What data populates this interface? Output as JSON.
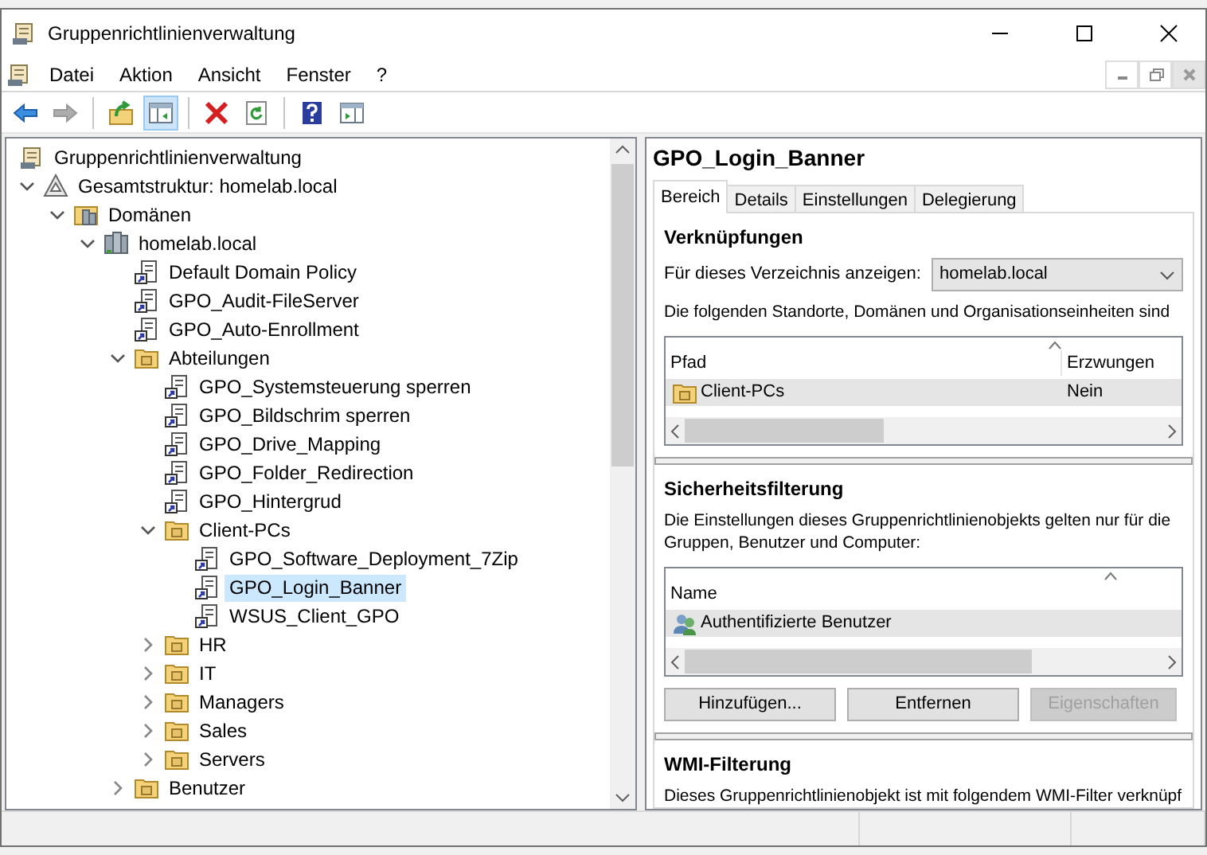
{
  "window": {
    "title": "Gruppenrichtlinienverwaltung"
  },
  "menu": [
    "Datei",
    "Aktion",
    "Ansicht",
    "Fenster",
    "?"
  ],
  "toolbar": [
    {
      "kind": "back",
      "disabled": false,
      "pressed": false
    },
    {
      "kind": "forward",
      "disabled": true,
      "pressed": false
    },
    {
      "kind": "separator"
    },
    {
      "kind": "up",
      "disabled": false,
      "pressed": false
    },
    {
      "kind": "tree",
      "disabled": false,
      "pressed": true
    },
    {
      "kind": "separator"
    },
    {
      "kind": "delete",
      "disabled": false,
      "pressed": false
    },
    {
      "kind": "refresh",
      "disabled": false,
      "pressed": false
    },
    {
      "kind": "separator"
    },
    {
      "kind": "help",
      "disabled": false,
      "pressed": false
    },
    {
      "kind": "pane",
      "disabled": false,
      "pressed": false
    }
  ],
  "tree": [
    {
      "label": "Gruppenrichtlinienverwaltung",
      "kind": "root",
      "selected": false,
      "children": [
        {
          "label": "Gesamtstruktur: homelab.local",
          "kind": "forest",
          "selected": false,
          "expanded": true,
          "children": [
            {
              "label": "Domänen",
              "kind": "domains",
              "selected": false,
              "expanded": true,
              "children": [
                {
                  "label": "homelab.local",
                  "kind": "domain",
                  "selected": false,
                  "expanded": true,
                  "children": [
                    {
                      "label": "Default Domain Policy",
                      "kind": "gpo",
                      "selected": false
                    },
                    {
                      "label": "GPO_Audit-FileServer",
                      "kind": "gpo",
                      "selected": false
                    },
                    {
                      "label": "GPO_Auto-Enrollment",
                      "kind": "gpo",
                      "selected": false
                    },
                    {
                      "label": "Abteilungen",
                      "kind": "ou",
                      "selected": false,
                      "expanded": true,
                      "children": [
                        {
                          "label": "GPO_Systemsteuerung sperren",
                          "kind": "gpo",
                          "selected": false
                        },
                        {
                          "label": "GPO_Bildschrim sperren",
                          "kind": "gpo",
                          "selected": false
                        },
                        {
                          "label": "GPO_Drive_Mapping",
                          "kind": "gpo",
                          "selected": false
                        },
                        {
                          "label": "GPO_Folder_Redirection",
                          "kind": "gpo",
                          "selected": false
                        },
                        {
                          "label": "GPO_Hintergrud",
                          "kind": "gpo",
                          "selected": false
                        },
                        {
                          "label": "Client-PCs",
                          "kind": "ou",
                          "selected": false,
                          "expanded": true,
                          "children": [
                            {
                              "label": "GPO_Software_Deployment_7Zip",
                              "kind": "gpo",
                              "selected": false
                            },
                            {
                              "label": "GPO_Login_Banner",
                              "kind": "gpo",
                              "selected": true
                            },
                            {
                              "label": "WSUS_Client_GPO",
                              "kind": "gpo",
                              "selected": false
                            }
                          ]
                        },
                        {
                          "label": "HR",
                          "kind": "ou",
                          "selected": false,
                          "expanded": false
                        },
                        {
                          "label": "IT",
                          "kind": "ou",
                          "selected": false,
                          "expanded": false
                        },
                        {
                          "label": "Managers",
                          "kind": "ou",
                          "selected": false,
                          "expanded": false
                        },
                        {
                          "label": "Sales",
                          "kind": "ou",
                          "selected": false,
                          "expanded": false
                        },
                        {
                          "label": "Servers",
                          "kind": "ou",
                          "selected": false,
                          "expanded": false
                        }
                      ]
                    },
                    {
                      "label": "Benutzer",
                      "kind": "ou",
                      "selected": false,
                      "expanded": false
                    }
                  ]
                }
              ]
            }
          ]
        }
      ]
    }
  ],
  "details": {
    "title": "GPO_Login_Banner",
    "tabs": [
      {
        "label": "Bereich",
        "selected": true
      },
      {
        "label": "Details",
        "selected": false
      },
      {
        "label": "Einstellungen",
        "selected": false
      },
      {
        "label": "Delegierung",
        "selected": false
      }
    ],
    "links": {
      "heading": "Verknüpfungen",
      "location_label": "Für dieses Verzeichnis anzeigen:",
      "location_value": "homelab.local",
      "description": "Die folgenden Standorte, Domänen und Organisationseinheiten sind",
      "columns": [
        "Pfad",
        "Erzwungen"
      ],
      "rows": [
        {
          "path": "Client-PCs",
          "enforced": "Nein",
          "selected": true
        }
      ]
    },
    "security": {
      "heading": "Sicherheitsfilterung",
      "description_lines": [
        "Die Einstellungen dieses Gruppenrichtlinienobjekts gelten nur für die",
        "Gruppen, Benutzer und Computer:"
      ],
      "columns": [
        "Name"
      ],
      "rows": [
        {
          "name": "Authentifizierte Benutzer",
          "selected": true
        }
      ],
      "buttons": [
        {
          "label": "Hinzufügen...",
          "disabled": false
        },
        {
          "label": "Entfernen",
          "disabled": false
        },
        {
          "label": "Eigenschaften",
          "disabled": true
        }
      ]
    },
    "wmi": {
      "heading": "WMI-Filterung",
      "description": "Dieses Gruppenrichtlinienobjekt ist mit folgendem WMI-Filter verknüpf"
    }
  }
}
